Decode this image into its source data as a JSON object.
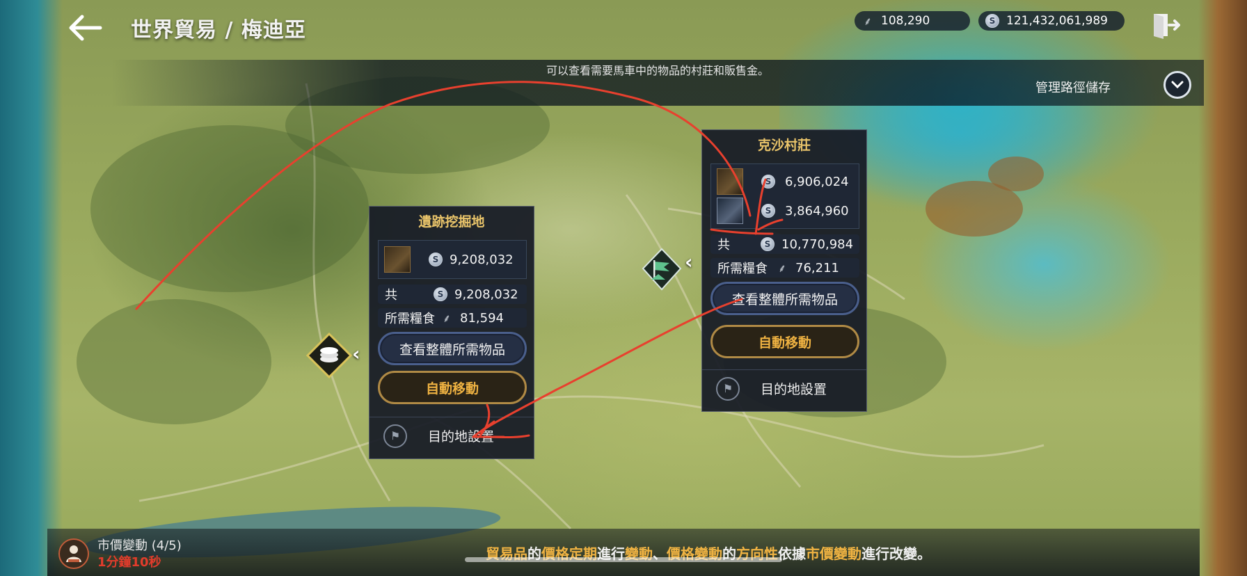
{
  "header": {
    "back_label": "",
    "title": "世界貿易 / 梅迪亞",
    "food_amount": "108,290",
    "silver_amount": "121,432,061,989"
  },
  "banner": {
    "info_text": "可以查看需要馬車中的物品的村莊和販售金。",
    "manage_label": "管理路徑儲存"
  },
  "villages": [
    {
      "name": "遺跡挖掘地",
      "items": [
        {
          "icon": "relic-item-icon",
          "price": "9,208,032"
        }
      ],
      "total_label": "共",
      "total_value": "9,208,032",
      "food_label": "所需糧食",
      "food_value": "81,594",
      "view_button": "查看整體所需物品",
      "auto_button": "自動移動",
      "dest_label": "目的地設置"
    },
    {
      "name": "克沙村莊",
      "items": [
        {
          "icon": "relic-item-icon",
          "price": "6,906,024"
        },
        {
          "icon": "chest-item-icon",
          "price": "3,864,960"
        }
      ],
      "total_label": "共",
      "total_value": "10,770,984",
      "food_label": "所需糧食",
      "food_value": "76,211",
      "view_button": "查看整體所需物品",
      "auto_button": "自動移動",
      "dest_label": "目的地設置"
    }
  ],
  "bottom": {
    "market_label": "市價變動 (4/5)",
    "market_timer": "1分鐘10秒",
    "notice_parts": [
      "貿易品",
      "的",
      "價格定期",
      "進行",
      "變動",
      "、",
      "價格變動",
      "的",
      "方向性",
      "依據",
      "市價變動",
      "進行改變。"
    ]
  },
  "colors": {
    "accent_gold": "#f0b342",
    "title_gold": "#e9c46a",
    "timer_red": "#e23c2c",
    "annotation_red": "#e8402e"
  }
}
